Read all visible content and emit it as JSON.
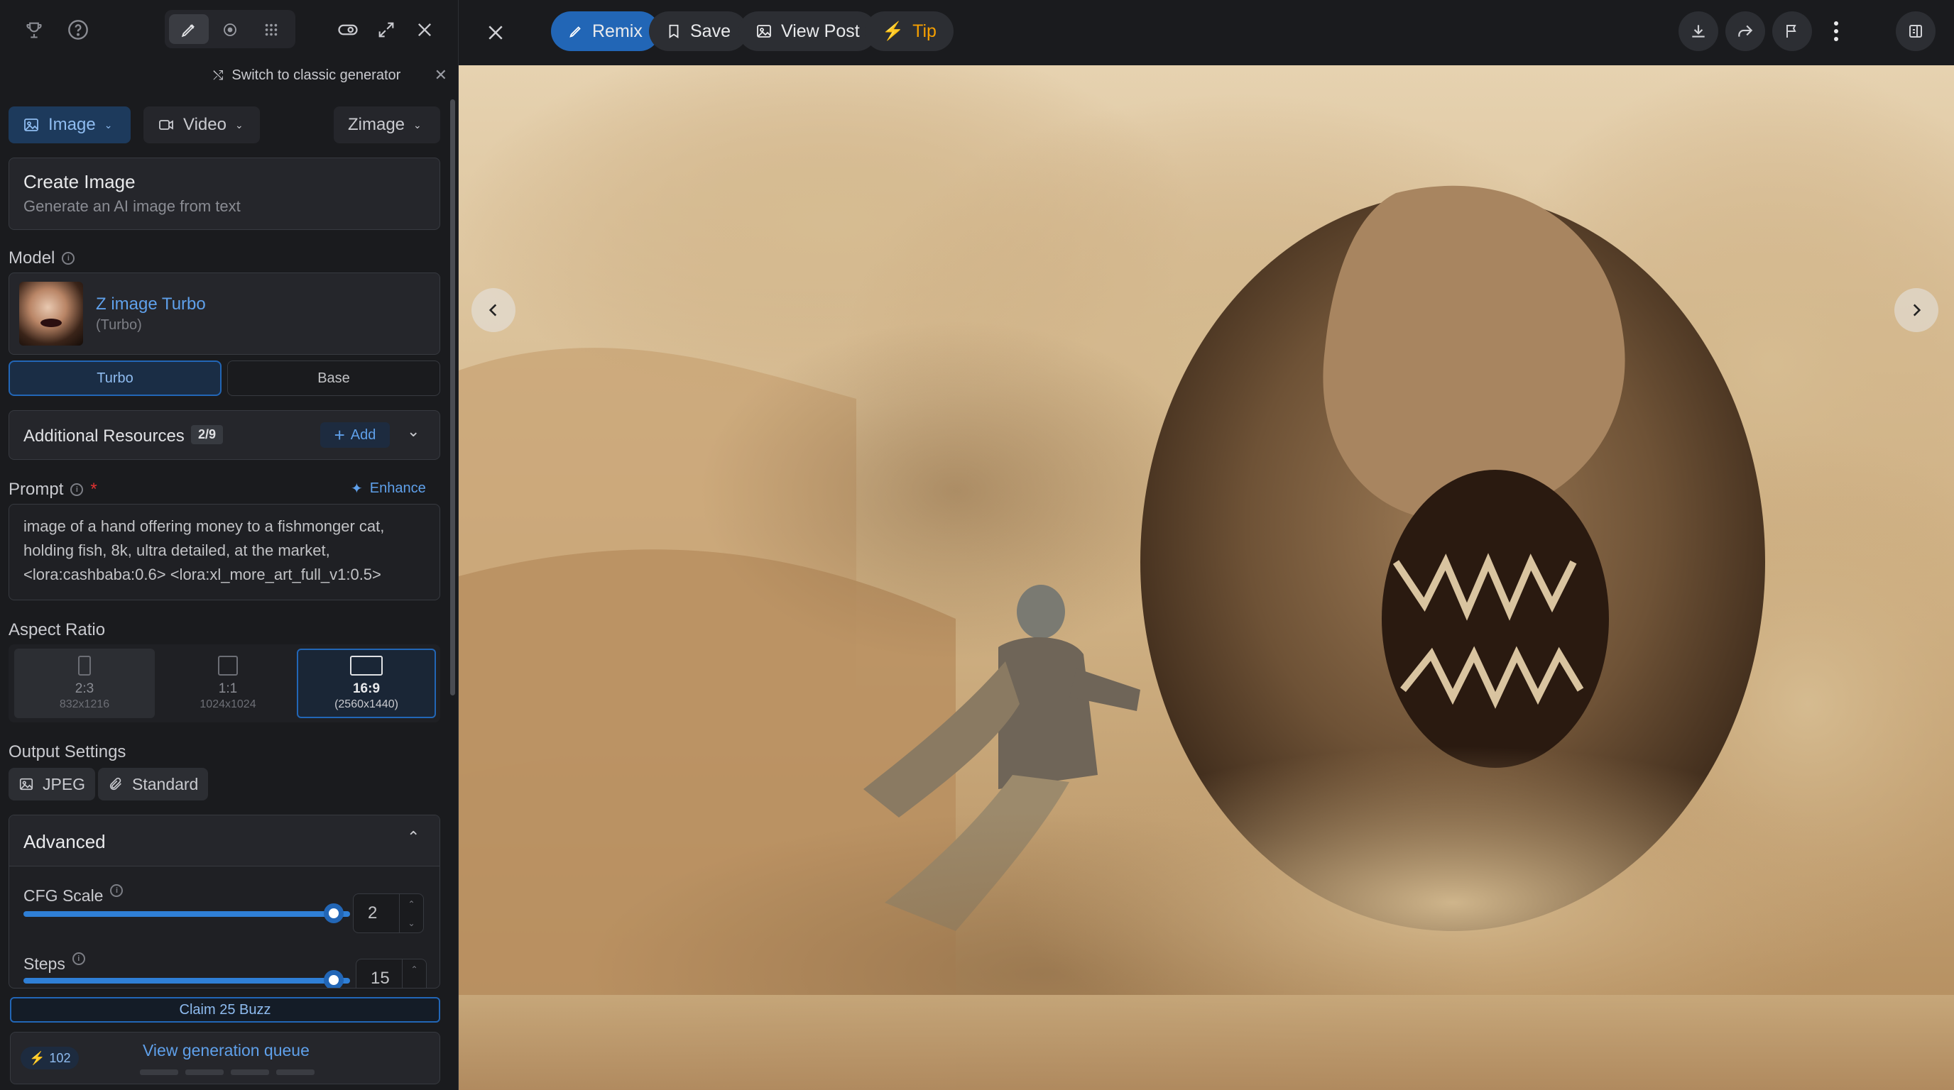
{
  "panel": {
    "switch_text": "Switch to classic generator",
    "tabs": {
      "image": "Image",
      "video": "Video",
      "engine": "Zimage"
    },
    "create": {
      "title": "Create Image",
      "subtitle": "Generate an AI image from text"
    },
    "model": {
      "label": "Model",
      "name": "Z image Turbo",
      "variant": "(Turbo)",
      "options": [
        "Turbo",
        "Base"
      ],
      "selected": "Turbo"
    },
    "resources": {
      "label": "Additional Resources",
      "count": "2/9",
      "add": "Add"
    },
    "prompt": {
      "label": "Prompt",
      "required_mark": "*",
      "enhance": "Enhance",
      "lines": [
        "image of a hand offering money to a fishmonger cat,",
        "holding fish, 8k, ultra detailed, at the market,",
        "<lora:cashbaba:0.6>  <lora:xl_more_art_full_v1:0.5>"
      ]
    },
    "aspect": {
      "label": "Aspect Ratio",
      "options": [
        {
          "ratio": "2:3",
          "size": "832x1216"
        },
        {
          "ratio": "1:1",
          "size": "1024x1024"
        },
        {
          "ratio": "16:9",
          "size": "(2560x1440)"
        }
      ],
      "selected": "16:9"
    },
    "output": {
      "label": "Output Settings",
      "format": "JPEG",
      "quality": "Standard"
    },
    "advanced": {
      "label": "Advanced",
      "cfg": {
        "label": "CFG Scale",
        "value": "2",
        "fill": 0.95
      },
      "steps": {
        "label": "Steps",
        "value": "15",
        "fill": 0.95
      }
    },
    "claim": "Claim 25 Buzz",
    "buzz": "102",
    "queue": "View generation queue"
  },
  "viewer": {
    "buttons": {
      "remix": "Remix",
      "save": "Save",
      "view_post": "View Post",
      "tip": "Tip"
    }
  },
  "colors": {
    "accent": "#2266b6",
    "tip": "#f59f00",
    "panel": "#1a1b1e",
    "card": "#25262b"
  }
}
